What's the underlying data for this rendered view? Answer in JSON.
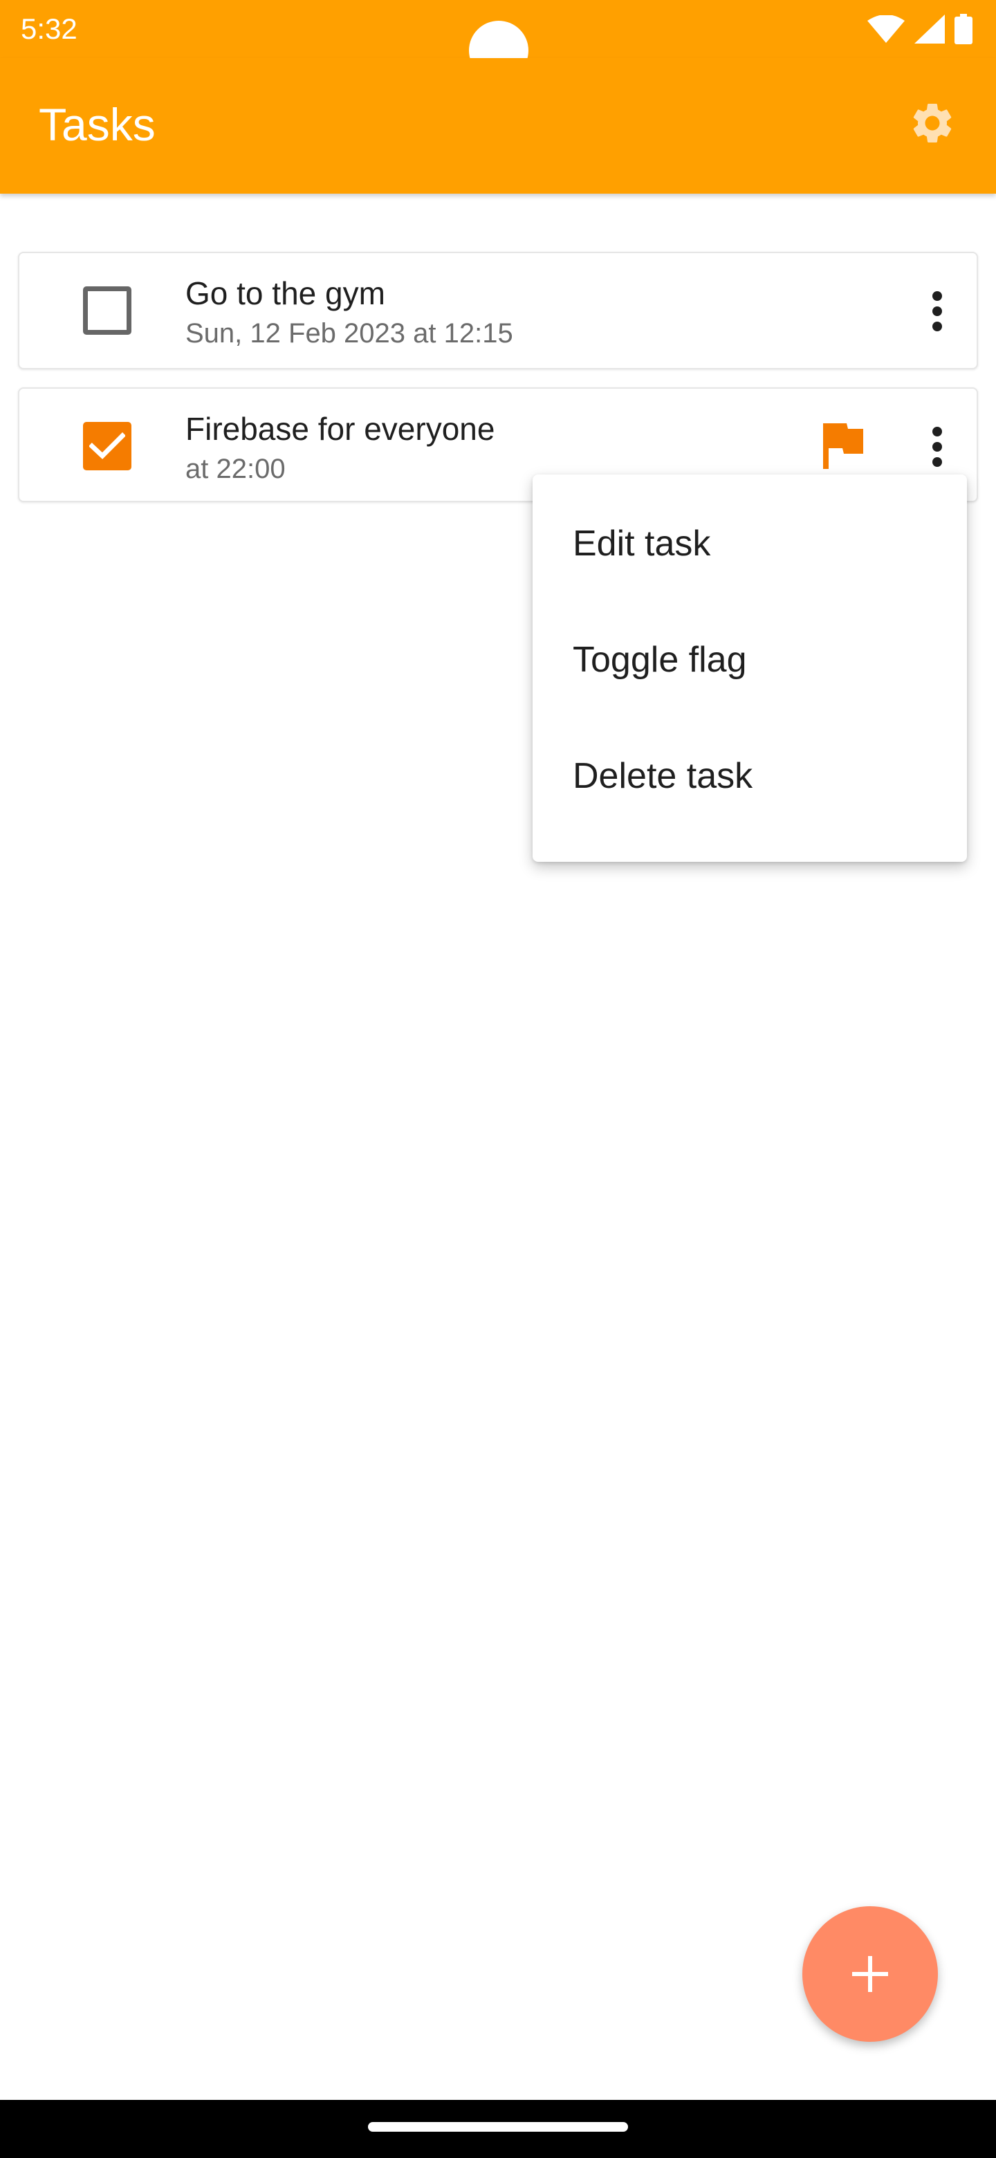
{
  "status_bar": {
    "time": "5:32",
    "icons": [
      "wifi-icon",
      "cellular-signal-icon",
      "battery-icon"
    ]
  },
  "app_bar": {
    "title": "Tasks",
    "settings_icon": "gear-icon",
    "background_color": "#FFA000"
  },
  "tasks": [
    {
      "title": "Go to the gym",
      "subtitle": "Sun, 12 Feb 2023 at 12:15",
      "completed": false,
      "flagged": false,
      "more_icon": "more-vert-icon"
    },
    {
      "title": "Firebase for everyone",
      "subtitle": "at 22:00",
      "completed": true,
      "flagged": true,
      "flag_icon": "flag-icon",
      "more_icon": "more-vert-icon"
    }
  ],
  "popup_menu": {
    "items": [
      "Edit task",
      "Toggle flag",
      "Delete task"
    ]
  },
  "fab": {
    "icon": "plus-icon",
    "color": "#FF8A65"
  },
  "colors": {
    "accent": "#F57C00",
    "app_bar": "#FFA000"
  }
}
